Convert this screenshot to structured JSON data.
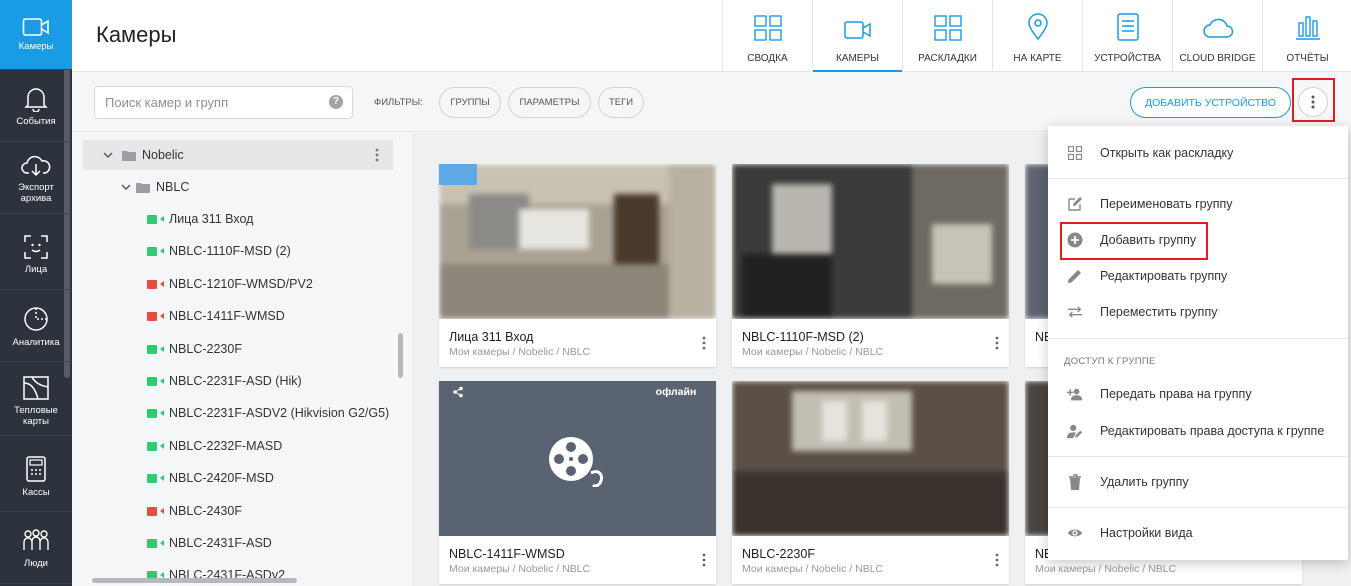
{
  "colors": {
    "accent": "#1a9be6",
    "online": "#2ecc71",
    "offline": "#e74c3c",
    "highlight": "#e01e1e",
    "nav_bg": "#2d333c"
  },
  "leftnav": {
    "items": [
      {
        "label": "Камеры",
        "icon": "camera-icon",
        "active": true
      },
      {
        "label": "События",
        "icon": "bell-icon"
      },
      {
        "label": "Экспорт архива",
        "icon": "cloud-download-icon"
      },
      {
        "label": "Лица",
        "icon": "face-icon"
      },
      {
        "label": "Аналитика",
        "icon": "analytics-icon"
      },
      {
        "label": "Тепловые карты",
        "icon": "heatmap-icon"
      },
      {
        "label": "Кассы",
        "icon": "cash-register-icon"
      },
      {
        "label": "Люди",
        "icon": "people-icon"
      }
    ]
  },
  "header": {
    "title": "Камеры",
    "tabs": [
      {
        "label": "СВОДКА",
        "icon": "dashboard-icon"
      },
      {
        "label": "КАМЕРЫ",
        "icon": "camera-icon",
        "active": true
      },
      {
        "label": "РАСКЛАДКИ",
        "icon": "layout-icon"
      },
      {
        "label": "НА КАРТЕ",
        "icon": "map-pin-icon"
      },
      {
        "label": "УСТРОЙСТВА",
        "icon": "devices-icon"
      },
      {
        "label": "CLOUD BRIDGE",
        "icon": "cloud-icon"
      },
      {
        "label": "ОТЧЁТЫ",
        "icon": "reports-icon"
      }
    ]
  },
  "toolbar": {
    "search_placeholder": "Поиск камер и групп",
    "help": "?",
    "filters_label": "ФИЛЬТРЫ:",
    "filters": [
      "ГРУППЫ",
      "ПАРАМЕТРЫ",
      "ТЕГИ"
    ],
    "add_device": "ДОБАВИТЬ УСТРОЙСТВО"
  },
  "tree": {
    "root": "Nobelic",
    "group": "NBLC",
    "cameras": [
      {
        "name": "Лица 311 Вход",
        "status": "online"
      },
      {
        "name": "NBLC-1110F-MSD (2)",
        "status": "online"
      },
      {
        "name": "NBLC-1210F-WMSD/PV2",
        "status": "offline"
      },
      {
        "name": "NBLC-1411F-WMSD",
        "status": "offline"
      },
      {
        "name": "NBLC-2230F",
        "status": "online"
      },
      {
        "name": "NBLC-2231F-ASD (Hik)",
        "status": "online"
      },
      {
        "name": "NBLC-2231F-ASDV2 (Hikvision G2/G5)",
        "status": "online"
      },
      {
        "name": "NBLC-2232F-MASD",
        "status": "online"
      },
      {
        "name": "NBLC-2420F-MSD",
        "status": "online"
      },
      {
        "name": "NBLC-2430F",
        "status": "offline"
      },
      {
        "name": "NBLC-2431F-ASD",
        "status": "online"
      },
      {
        "name": "NBLC-2431F-ASDv2",
        "status": "online"
      }
    ]
  },
  "cards": [
    {
      "name": "Лица 311 Вход",
      "path": "Мои камеры / Nobelic / NBLC"
    },
    {
      "name": "NBLC-1110F-MSD (2)",
      "path": "Мои камеры / Nobelic / NBLC"
    },
    {
      "name": "NB",
      "path": ""
    },
    {
      "name": "NBLC-1411F-WMSD",
      "path": "Мои камеры / Nobelic / NBLC",
      "badge": "офлайн"
    },
    {
      "name": "NBLC-2230F",
      "path": "Мои камеры / Nobelic / NBLC"
    },
    {
      "name": "NB",
      "path": "Мои камеры / Nobelic / NBLC"
    }
  ],
  "menu": {
    "items": [
      {
        "label": "Открыть как раскладку",
        "icon": "grid-icon"
      },
      {
        "label": "Переименовать группу",
        "icon": "rename-icon"
      },
      {
        "label": "Добавить группу",
        "icon": "add-circle-icon"
      },
      {
        "label": "Редактировать группу",
        "icon": "pencil-icon"
      },
      {
        "label": "Переместить группу",
        "icon": "move-icon"
      },
      {
        "label": "Передать права на группу",
        "icon": "person-add-icon"
      },
      {
        "label": "Редактировать права доступа к группе",
        "icon": "person-edit-icon"
      },
      {
        "label": "Удалить группу",
        "icon": "trash-icon"
      },
      {
        "label": "Настройки вида",
        "icon": "eye-icon"
      }
    ],
    "section": "ДОСТУП К ГРУППЕ"
  }
}
